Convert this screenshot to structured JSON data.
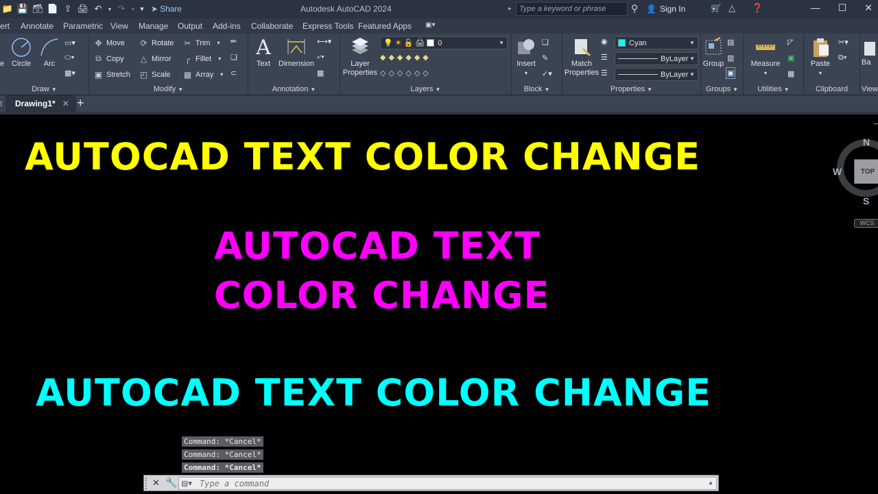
{
  "titlebar": {
    "share_label": "Share",
    "app_title": "Autodesk AutoCAD 2024",
    "search_placeholder": "Type a keyword or phrase",
    "signin_label": "Sign In"
  },
  "ribbon_tabs": [
    "ert",
    "Annotate",
    "Parametric",
    "View",
    "Manage",
    "Output",
    "Add-ins",
    "Collaborate",
    "Express Tools",
    "Featured Apps"
  ],
  "ribbon": {
    "draw": {
      "title": "Draw",
      "circle": "Circle",
      "arc": "Arc",
      "line_partial": "e"
    },
    "modify": {
      "title": "Modify",
      "move": "Move",
      "rotate": "Rotate",
      "trim": "Trim",
      "copy": "Copy",
      "mirror": "Mirror",
      "fillet": "Fillet",
      "stretch": "Stretch",
      "scale": "Scale",
      "array": "Array"
    },
    "annotation": {
      "title": "Annotation",
      "text": "Text",
      "dimension": "Dimension"
    },
    "layers": {
      "title": "Layers",
      "layer_properties_1": "Layer",
      "layer_properties_2": "Properties",
      "current_layer": "0"
    },
    "block": {
      "title": "Block",
      "insert": "Insert"
    },
    "properties": {
      "title": "Properties",
      "match_1": "Match",
      "match_2": "Properties",
      "color": "Cyan",
      "linetype": "ByLayer",
      "lineweight": "ByLayer",
      "color_hex": "#00ffff"
    },
    "groups": {
      "title": "Groups",
      "group": "Group"
    },
    "utilities": {
      "title": "Utilities",
      "measure": "Measure"
    },
    "clipboard": {
      "title": "Clipboard",
      "paste": "Paste"
    },
    "view_partial": {
      "title": "View",
      "ba": "Ba"
    }
  },
  "doc_tabs": {
    "active": "Drawing1*"
  },
  "canvas": {
    "text_yellow": "AUTOCAD  TEXT COLOR CHANGE",
    "text_magenta_line1": "AUTOCAD TEXT",
    "text_magenta_line2": "COLOR CHANGE",
    "text_cyan": "AUTOCAD  TEXT COLOR CHANGE",
    "colors": {
      "yellow": "#ffff00",
      "magenta": "#ff00ff",
      "cyan": "#00ffff"
    }
  },
  "viewcube": {
    "north": "N",
    "south": "S",
    "west": "W",
    "face": "TOP",
    "wcs": "WCS"
  },
  "command_history": [
    "Command: *Cancel*",
    "Command: *Cancel*",
    "Command: *Cancel*"
  ],
  "command_line": {
    "placeholder": "Type a command"
  }
}
